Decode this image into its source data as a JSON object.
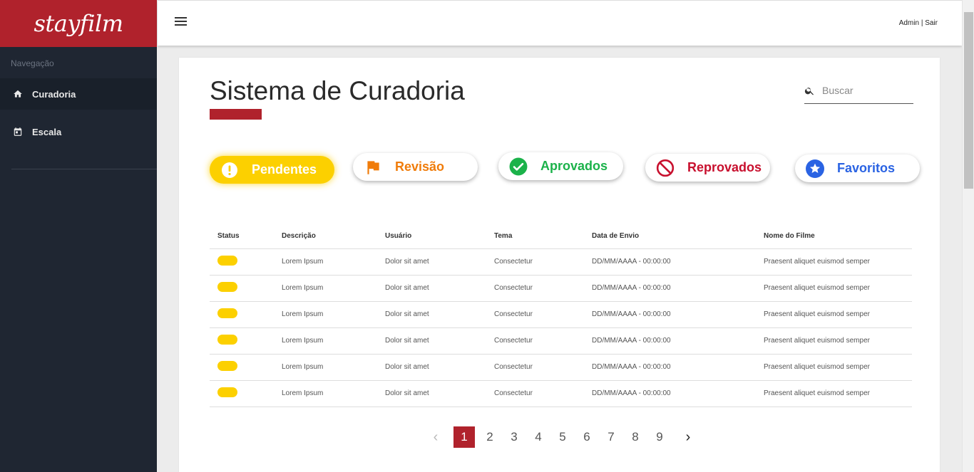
{
  "brand": {
    "logo": "stayfilm"
  },
  "sidebar": {
    "heading": "Navegação",
    "items": [
      {
        "label": "Curadoria",
        "icon": "home-icon"
      },
      {
        "label": "Escala",
        "icon": "calendar-icon"
      }
    ]
  },
  "topbar": {
    "user_links": "Admin | Sair"
  },
  "page": {
    "title": "Sistema de Curadoria"
  },
  "search": {
    "placeholder": "Buscar"
  },
  "filters": [
    {
      "label": "Pendentes",
      "icon": "exclamation-icon",
      "color": "#fcd000"
    },
    {
      "label": "Revisão",
      "icon": "flag-icon",
      "color": "#f07c0a"
    },
    {
      "label": "Aprovados",
      "icon": "check-circle-icon",
      "color": "#1bb24a"
    },
    {
      "label": "Reprovados",
      "icon": "block-icon",
      "color": "#c8102e"
    },
    {
      "label": "Favoritos",
      "icon": "star-circle-icon",
      "color": "#2a63e3"
    }
  ],
  "table": {
    "headers": [
      "Status",
      "Descrição",
      "Usuário",
      "Tema",
      "Data de Envio",
      "Nome do Filme"
    ],
    "rows": [
      {
        "status": "pendente",
        "descricao": "Lorem Ipsum",
        "usuario": "Dolor sit amet",
        "tema": "Consectetur",
        "data": "DD/MM/AAAA - 00:00:00",
        "filme": "Praesent aliquet euismod semper"
      },
      {
        "status": "pendente",
        "descricao": "Lorem Ipsum",
        "usuario": "Dolor sit amet",
        "tema": "Consectetur",
        "data": "DD/MM/AAAA - 00:00:00",
        "filme": "Praesent aliquet euismod semper"
      },
      {
        "status": "pendente",
        "descricao": "Lorem Ipsum",
        "usuario": "Dolor sit amet",
        "tema": "Consectetur",
        "data": "DD/MM/AAAA - 00:00:00",
        "filme": "Praesent aliquet euismod semper"
      },
      {
        "status": "pendente",
        "descricao": "Lorem Ipsum",
        "usuario": "Dolor sit amet",
        "tema": "Consectetur",
        "data": "DD/MM/AAAA - 00:00:00",
        "filme": "Praesent aliquet euismod semper"
      },
      {
        "status": "pendente",
        "descricao": "Lorem Ipsum",
        "usuario": "Dolor sit amet",
        "tema": "Consectetur",
        "data": "DD/MM/AAAA - 00:00:00",
        "filme": "Praesent aliquet euismod semper"
      },
      {
        "status": "pendente",
        "descricao": "Lorem Ipsum",
        "usuario": "Dolor sit amet",
        "tema": "Consectetur",
        "data": "DD/MM/AAAA - 00:00:00",
        "filme": "Praesent aliquet euismod semper"
      }
    ]
  },
  "pagination": {
    "prev": "‹",
    "pages": [
      "1",
      "2",
      "3",
      "4",
      "5",
      "6",
      "7",
      "8",
      "9"
    ],
    "current": "1",
    "next": "›"
  },
  "colors": {
    "brand_red": "#b0222c",
    "sidebar_bg": "#1f2632",
    "pending_yellow": "#fcd000"
  }
}
